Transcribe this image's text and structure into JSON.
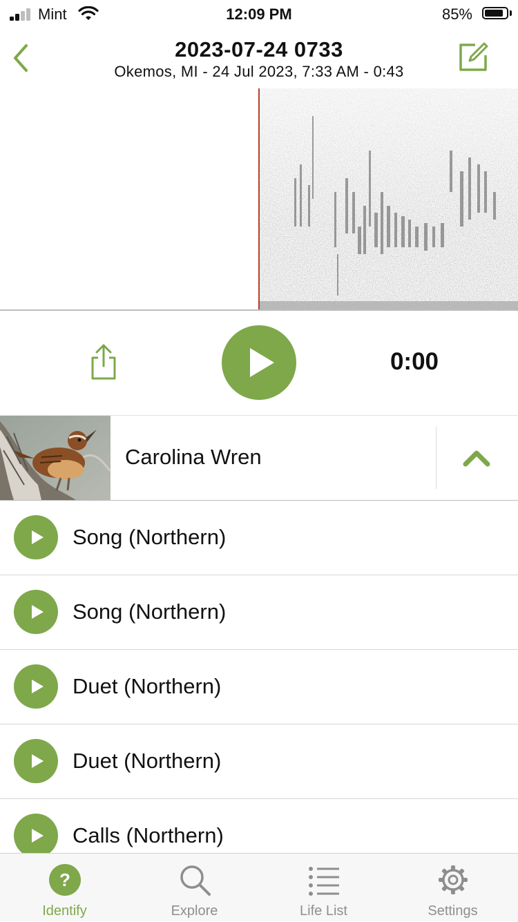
{
  "status_bar": {
    "carrier": "Mint",
    "time": "12:09 PM",
    "battery_percent": "85%",
    "battery_level": 0.85
  },
  "header": {
    "title": "2023-07-24 0733",
    "subtitle": "Okemos, MI - 24 Jul 2023, 7:33 AM - 0:43",
    "back_icon": "chevron-left-icon",
    "edit_icon": "edit-square-pencil-icon"
  },
  "player": {
    "time": "0:00",
    "share_icon": "share-icon",
    "play_icon": "play-icon"
  },
  "species": {
    "name": "Carolina Wren",
    "collapse_icon": "chevron-up-icon"
  },
  "recordings": [
    {
      "label": "Song (Northern)"
    },
    {
      "label": "Song (Northern)"
    },
    {
      "label": "Duet (Northern)"
    },
    {
      "label": "Duet (Northern)"
    },
    {
      "label": "Calls (Northern)"
    }
  ],
  "tabs": [
    {
      "label": "Identify",
      "icon": "question-circle-icon",
      "active": true
    },
    {
      "label": "Explore",
      "icon": "search-icon",
      "active": false
    },
    {
      "label": "Life List",
      "icon": "list-icon",
      "active": false
    },
    {
      "label": "Settings",
      "icon": "gear-icon",
      "active": false
    }
  ],
  "colors": {
    "accent": "#7ea84a",
    "playhead": "#b5402a",
    "inactive_tab": "#8e8e8e"
  }
}
